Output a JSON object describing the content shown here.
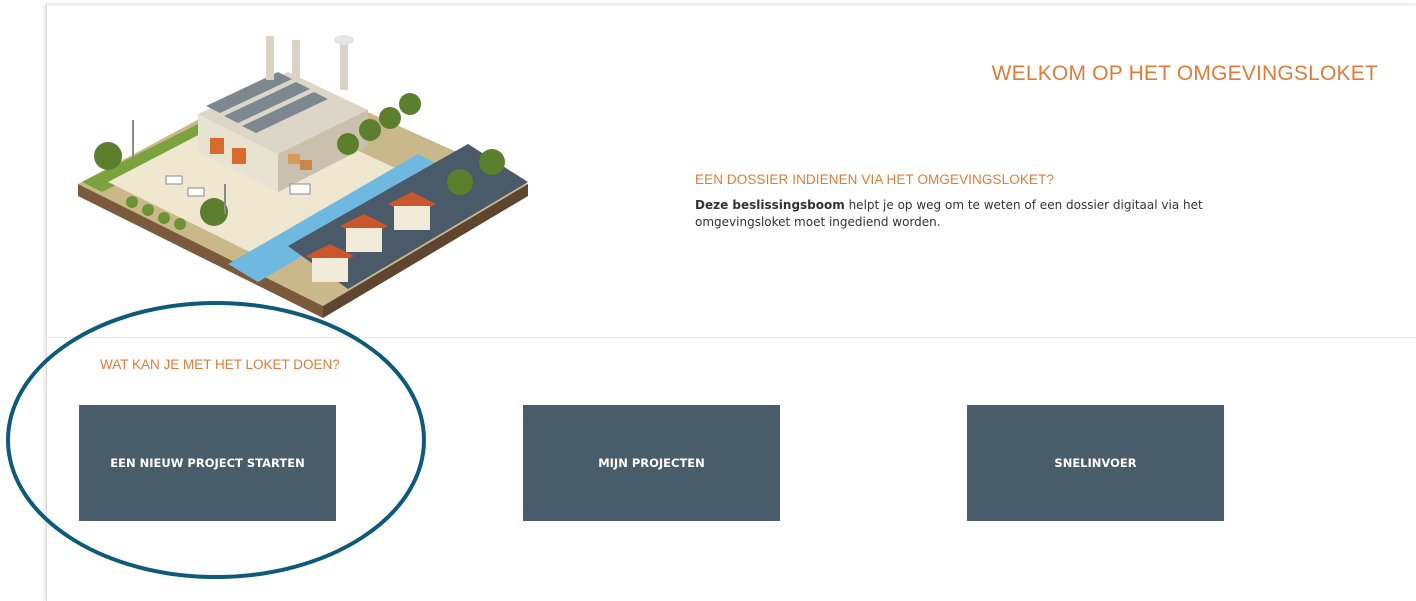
{
  "header": {
    "title": "WELKOM OP HET OMGEVINGSLOKET"
  },
  "intro": {
    "heading": "EEN DOSSIER INDIENEN VIA HET OMGEVINGSLOKET?",
    "link_text": "Deze beslissingsboom",
    "body_text": " helpt je op weg om te weten of een dossier digitaal via het omgevingsloket moet ingediend worden."
  },
  "actions": {
    "heading": "WAT KAN JE MET HET LOKET DOEN?",
    "tiles": [
      {
        "label": "EEN NIEUW PROJECT STARTEN"
      },
      {
        "label": "MIJN PROJECTEN"
      },
      {
        "label": "SNELINVOER"
      }
    ]
  },
  "annotation": {
    "highlight_color": "#0d5a7a"
  },
  "colors": {
    "accent": "#e07b39",
    "tile_background": "#495c69",
    "tile_text": "#ffffff"
  }
}
